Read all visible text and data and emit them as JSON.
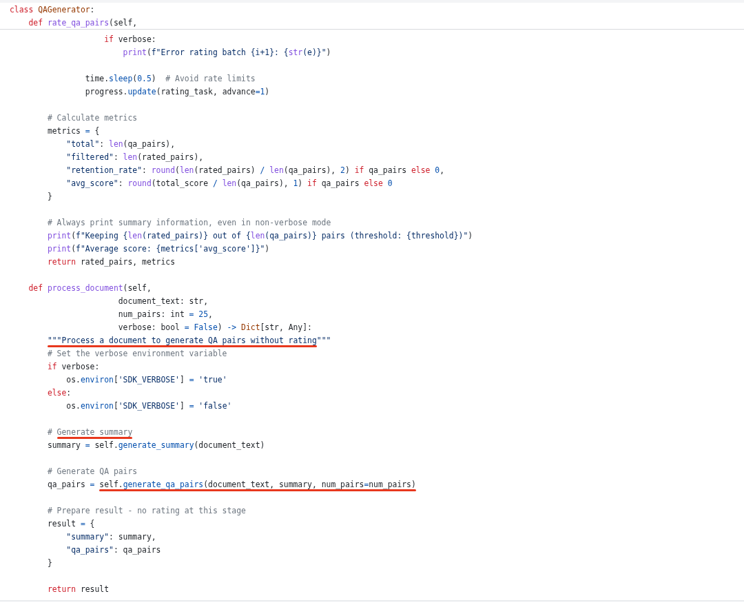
{
  "header": {
    "lines": [
      {
        "tokens": [
          {
            "kind": "keyword",
            "text": "class "
          },
          {
            "kind": "class",
            "text": "QAGenerator"
          },
          {
            "kind": "text",
            "text": ":"
          }
        ]
      },
      {
        "tokens": [
          {
            "kind": "keyword",
            "text": "    def "
          },
          {
            "kind": "function",
            "text": "rate_qa_pairs"
          },
          {
            "kind": "text",
            "text": "(self,"
          }
        ]
      }
    ]
  },
  "blocks": [
    {
      "lines": [
        {
          "tokens": [
            {
              "kind": "keyword",
              "text": "                    if"
            },
            {
              "kind": "text",
              "text": " verbose:"
            }
          ]
        },
        {
          "tokens": [
            {
              "kind": "function",
              "text": "                        print"
            },
            {
              "kind": "text",
              "text": "("
            },
            {
              "kind": "string",
              "text": "f\"Error rating batch {i+1}: {"
            },
            {
              "kind": "function",
              "text": "str"
            },
            {
              "kind": "string",
              "text": "(e)}\""
            },
            {
              "kind": "text",
              "text": ")"
            }
          ]
        }
      ]
    },
    {
      "lines": [
        {
          "tokens": [
            {
              "kind": "text",
              "text": "                time."
            },
            {
              "kind": "method",
              "text": "sleep"
            },
            {
              "kind": "text",
              "text": "("
            },
            {
              "kind": "number",
              "text": "0.5"
            },
            {
              "kind": "text",
              "text": ")  "
            },
            {
              "kind": "comment",
              "text": "# Avoid rate limits"
            }
          ]
        },
        {
          "tokens": [
            {
              "kind": "text",
              "text": "                progress."
            },
            {
              "kind": "method",
              "text": "update"
            },
            {
              "kind": "text",
              "text": "(rating_task, advance"
            },
            {
              "kind": "operator",
              "text": "="
            },
            {
              "kind": "number",
              "text": "1"
            },
            {
              "kind": "text",
              "text": ")"
            }
          ]
        }
      ]
    },
    {
      "lines": [
        {
          "tokens": [
            {
              "kind": "comment",
              "text": "        # Calculate metrics"
            }
          ]
        },
        {
          "tokens": [
            {
              "kind": "text",
              "text": "        metrics "
            },
            {
              "kind": "operator",
              "text": "="
            },
            {
              "kind": "text",
              "text": " {"
            }
          ]
        },
        {
          "tokens": [
            {
              "kind": "string",
              "text": "            \"total\""
            },
            {
              "kind": "text",
              "text": ": "
            },
            {
              "kind": "function",
              "text": "len"
            },
            {
              "kind": "text",
              "text": "(qa_pairs),"
            }
          ]
        },
        {
          "tokens": [
            {
              "kind": "string",
              "text": "            \"filtered\""
            },
            {
              "kind": "text",
              "text": ": "
            },
            {
              "kind": "function",
              "text": "len"
            },
            {
              "kind": "text",
              "text": "(rated_pairs),"
            }
          ]
        },
        {
          "tokens": [
            {
              "kind": "string",
              "text": "            \"retention_rate\""
            },
            {
              "kind": "text",
              "text": ": "
            },
            {
              "kind": "function",
              "text": "round"
            },
            {
              "kind": "text",
              "text": "("
            },
            {
              "kind": "function",
              "text": "len"
            },
            {
              "kind": "text",
              "text": "(rated_pairs) "
            },
            {
              "kind": "operator",
              "text": "/ "
            },
            {
              "kind": "function",
              "text": "len"
            },
            {
              "kind": "text",
              "text": "(qa_pairs), "
            },
            {
              "kind": "number",
              "text": "2"
            },
            {
              "kind": "text",
              "text": ") "
            },
            {
              "kind": "keyword",
              "text": "if"
            },
            {
              "kind": "text",
              "text": " qa_pairs "
            },
            {
              "kind": "keyword",
              "text": "else "
            },
            {
              "kind": "number",
              "text": "0"
            },
            {
              "kind": "text",
              "text": ","
            }
          ]
        },
        {
          "tokens": [
            {
              "kind": "string",
              "text": "            \"avg_score\""
            },
            {
              "kind": "text",
              "text": ": "
            },
            {
              "kind": "function",
              "text": "round"
            },
            {
              "kind": "text",
              "text": "(total_score "
            },
            {
              "kind": "operator",
              "text": "/ "
            },
            {
              "kind": "function",
              "text": "len"
            },
            {
              "kind": "text",
              "text": "(qa_pairs), "
            },
            {
              "kind": "number",
              "text": "1"
            },
            {
              "kind": "text",
              "text": ") "
            },
            {
              "kind": "keyword",
              "text": "if"
            },
            {
              "kind": "text",
              "text": " qa_pairs "
            },
            {
              "kind": "keyword",
              "text": "else "
            },
            {
              "kind": "number",
              "text": "0"
            }
          ]
        },
        {
          "tokens": [
            {
              "kind": "text",
              "text": "        }"
            }
          ]
        }
      ]
    },
    {
      "lines": [
        {
          "tokens": [
            {
              "kind": "comment",
              "text": "        # Always print summary information, even in non-verbose mode"
            }
          ]
        },
        {
          "tokens": [
            {
              "kind": "function",
              "text": "        print"
            },
            {
              "kind": "text",
              "text": "("
            },
            {
              "kind": "string",
              "text": "f\"Keeping {"
            },
            {
              "kind": "function",
              "text": "len"
            },
            {
              "kind": "string",
              "text": "(rated_pairs)} out of {"
            },
            {
              "kind": "function",
              "text": "len"
            },
            {
              "kind": "string",
              "text": "(qa_pairs)} pairs (threshold: {threshold})\""
            },
            {
              "kind": "text",
              "text": ")"
            }
          ]
        },
        {
          "tokens": [
            {
              "kind": "function",
              "text": "        print"
            },
            {
              "kind": "text",
              "text": "("
            },
            {
              "kind": "string",
              "text": "f\"Average score: {metrics['avg_score']}\""
            },
            {
              "kind": "text",
              "text": ")"
            }
          ]
        },
        {
          "tokens": [
            {
              "kind": "keyword",
              "text": "        return"
            },
            {
              "kind": "text",
              "text": " rated_pairs, metrics"
            }
          ]
        }
      ]
    },
    {
      "lines": [
        {
          "tokens": [
            {
              "kind": "keyword",
              "text": "    def "
            },
            {
              "kind": "function",
              "text": "process_document"
            },
            {
              "kind": "text",
              "text": "(self,"
            }
          ]
        },
        {
          "tokens": [
            {
              "kind": "text",
              "text": "                       document_text: str,"
            }
          ]
        },
        {
          "tokens": [
            {
              "kind": "text",
              "text": "                       num_pairs: int "
            },
            {
              "kind": "operator",
              "text": "= "
            },
            {
              "kind": "number",
              "text": "25"
            },
            {
              "kind": "text",
              "text": ","
            }
          ]
        },
        {
          "tokens": [
            {
              "kind": "text",
              "text": "                       verbose: bool "
            },
            {
              "kind": "operator",
              "text": "= "
            },
            {
              "kind": "number",
              "text": "False"
            },
            {
              "kind": "text",
              "text": ") "
            },
            {
              "kind": "operator",
              "text": "-> "
            },
            {
              "kind": "class",
              "text": "Dict"
            },
            {
              "kind": "text",
              "text": "[str, Any]:"
            }
          ]
        },
        {
          "marked": [
            {
              "kind": "string",
              "text": "        \"\"\"Process a document to generate QA pairs without rating"
            }
          ],
          "after": [
            {
              "kind": "string",
              "text": "\"\"\""
            }
          ]
        },
        {
          "tokens": [
            {
              "kind": "comment",
              "text": "        # Set the verbose environment variable"
            }
          ]
        },
        {
          "tokens": [
            {
              "kind": "keyword",
              "text": "        if"
            },
            {
              "kind": "text",
              "text": " verbose:"
            }
          ]
        },
        {
          "tokens": [
            {
              "kind": "text",
              "text": "            os."
            },
            {
              "kind": "method",
              "text": "environ"
            },
            {
              "kind": "text",
              "text": "["
            },
            {
              "kind": "string",
              "text": "'SDK_VERBOSE'"
            },
            {
              "kind": "text",
              "text": "] "
            },
            {
              "kind": "operator",
              "text": "= "
            },
            {
              "kind": "string",
              "text": "'true'"
            }
          ]
        },
        {
          "tokens": [
            {
              "kind": "keyword",
              "text": "        else"
            },
            {
              "kind": "text",
              "text": ":"
            }
          ]
        },
        {
          "tokens": [
            {
              "kind": "text",
              "text": "            os."
            },
            {
              "kind": "method",
              "text": "environ"
            },
            {
              "kind": "text",
              "text": "["
            },
            {
              "kind": "string",
              "text": "'SDK_VERBOSE'"
            },
            {
              "kind": "text",
              "text": "] "
            },
            {
              "kind": "operator",
              "text": "= "
            },
            {
              "kind": "string",
              "text": "'false'"
            }
          ]
        }
      ]
    },
    {
      "lines": [
        {
          "tokens": [
            {
              "kind": "comment",
              "text": "        # "
            }
          ],
          "marked": [
            {
              "kind": "comment",
              "text": "Generate summary"
            }
          ]
        },
        {
          "tokens": [
            {
              "kind": "text",
              "text": "        summary "
            },
            {
              "kind": "operator",
              "text": "="
            },
            {
              "kind": "text",
              "text": " self."
            },
            {
              "kind": "method",
              "text": "generate_summary"
            },
            {
              "kind": "text",
              "text": "(document_text)"
            }
          ]
        }
      ]
    },
    {
      "lines": [
        {
          "tokens": [
            {
              "kind": "comment",
              "text": "        # Generate QA pairs"
            }
          ]
        },
        {
          "tokens": [
            {
              "kind": "text",
              "text": "        qa_pairs "
            },
            {
              "kind": "operator",
              "text": "= "
            }
          ],
          "marked": [
            {
              "kind": "text",
              "text": "self."
            },
            {
              "kind": "method",
              "text": "generate_qa_pairs"
            },
            {
              "kind": "text",
              "text": "(document_text, summary, num_pairs"
            },
            {
              "kind": "operator",
              "text": "="
            },
            {
              "kind": "text",
              "text": "num_pairs)"
            }
          ]
        }
      ]
    },
    {
      "lines": [
        {
          "tokens": [
            {
              "kind": "comment",
              "text": "        # Prepare result - no rating at this stage"
            }
          ]
        },
        {
          "tokens": [
            {
              "kind": "text",
              "text": "        result "
            },
            {
              "kind": "operator",
              "text": "="
            },
            {
              "kind": "text",
              "text": " {"
            }
          ]
        },
        {
          "tokens": [
            {
              "kind": "string",
              "text": "            \"summary\""
            },
            {
              "kind": "text",
              "text": ": summary,"
            }
          ]
        },
        {
          "tokens": [
            {
              "kind": "string",
              "text": "            \"qa_pairs\""
            },
            {
              "kind": "text",
              "text": ": qa_pairs"
            }
          ]
        },
        {
          "tokens": [
            {
              "kind": "text",
              "text": "        }"
            }
          ]
        }
      ]
    },
    {
      "lines": [
        {
          "tokens": [
            {
              "kind": "keyword",
              "text": "        return"
            },
            {
              "kind": "text",
              "text": " result"
            }
          ]
        }
      ]
    }
  ]
}
